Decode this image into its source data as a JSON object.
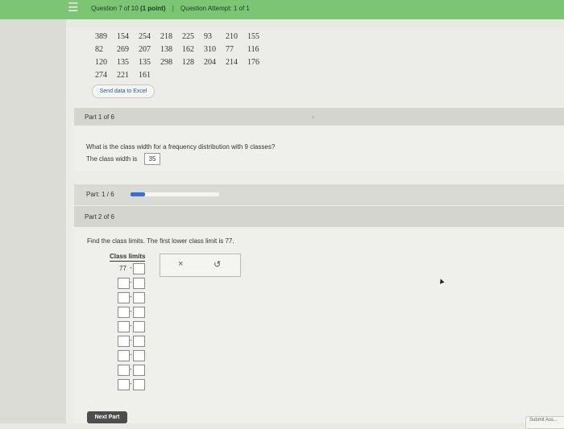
{
  "header": {
    "menu_icon": "hamburger-icon",
    "question_label": "Question 7 of 10",
    "points": "(1 point)",
    "separator": "|",
    "attempt": "Question Attempt: 1 of 1"
  },
  "data_table": {
    "rows": [
      [
        "389",
        "154",
        "254",
        "218",
        "225",
        "93",
        "210",
        "155"
      ],
      [
        "82",
        "269",
        "207",
        "138",
        "162",
        "310",
        "77",
        "116"
      ],
      [
        "120",
        "135",
        "135",
        "298",
        "128",
        "204",
        "214",
        "176"
      ],
      [
        "274",
        "221",
        "161"
      ]
    ]
  },
  "excel_button": {
    "label": "Send data to Excel"
  },
  "part1": {
    "header": "Part 1 of 6",
    "question": "What is the class width for a frequency distribution with 9 classes?",
    "answer_label": "The class width is",
    "answer_value": "35"
  },
  "progress": {
    "label": "Part: 1 / 6",
    "fraction": 0.1667,
    "color": "#3a6fd0"
  },
  "part2": {
    "header": "Part 2 of 6",
    "question": "Find the class limits. The first lower class limit is 77.",
    "table_header": "Class limits",
    "first_lower": "77",
    "dash": "-",
    "row_count": 9
  },
  "toolbox": {
    "clear_icon": "close-icon",
    "clear_symbol": "×",
    "undo_icon": "undo-icon",
    "undo_symbol": "↺"
  },
  "footer": {
    "next_label": "Next Part",
    "submit_label": "Submit Ass..."
  }
}
